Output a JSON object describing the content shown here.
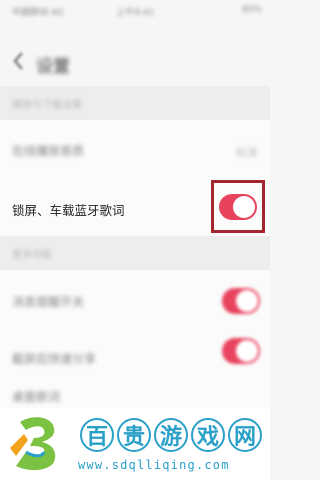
{
  "status_bar": {
    "carrier": "中国移动 4G",
    "time": "上午9:41",
    "battery": "80%"
  },
  "header": {
    "title": "设置"
  },
  "sections": [
    {
      "header": "播放与下载设置"
    },
    {
      "header": "更多功能"
    }
  ],
  "rows": {
    "row1": {
      "label": "在线播放音质",
      "value": "标准"
    },
    "lock_screen": {
      "label": "锁屏、车载蓝牙歌词",
      "on": true
    },
    "row3": {
      "label": "消息提醒开关",
      "on": true
    },
    "row4": {
      "label": "截屏后快速分享",
      "on": true
    },
    "row5": {
      "label": "桌面歌词"
    }
  },
  "watermark": {
    "brand": [
      "百",
      "贵",
      "游",
      "戏",
      "网"
    ],
    "url": "www.sdqlliqing.com"
  },
  "colors": {
    "toggle_on": "#e8435e",
    "highlight": "#a3252d",
    "watermark": "#2aa0c8"
  }
}
